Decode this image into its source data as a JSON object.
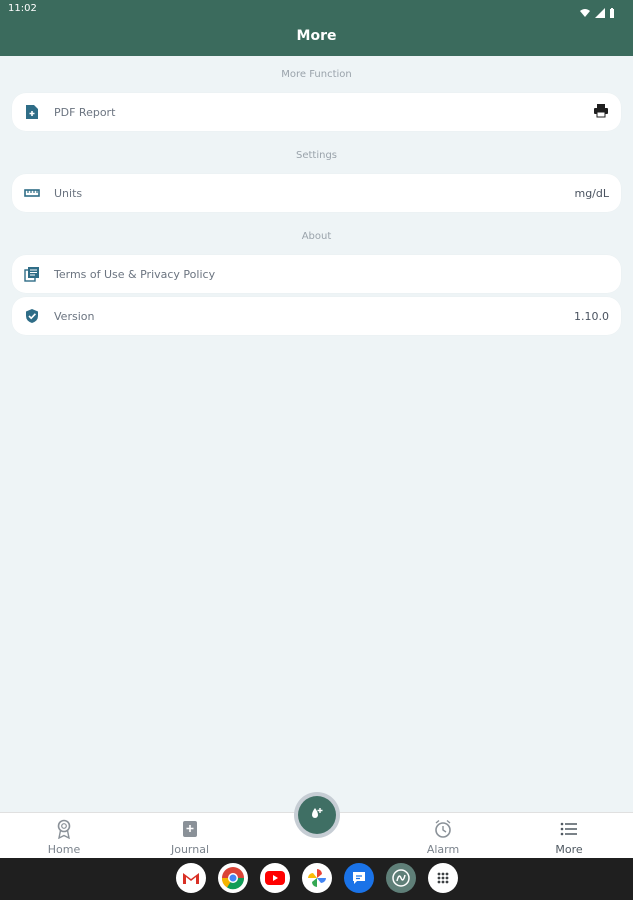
{
  "status_bar": {
    "time": "11:02"
  },
  "header": {
    "title": "More"
  },
  "sections": {
    "more_function": {
      "title": "More Function",
      "items": [
        {
          "label": "PDF Report",
          "icon": "pdf-file-icon",
          "action_icon": "printer-icon"
        }
      ]
    },
    "settings": {
      "title": "Settings",
      "items": [
        {
          "label": "Units",
          "value": "mg/dL",
          "icon": "ruler-icon"
        }
      ]
    },
    "about": {
      "title": "About",
      "items": [
        {
          "label": "Terms of Use & Privacy Policy",
          "icon": "document-list-icon"
        },
        {
          "label": "Version",
          "value": "1.10.0",
          "icon": "shield-check-icon"
        }
      ]
    }
  },
  "bottom_nav": {
    "items": [
      {
        "label": "Home",
        "icon": "award-icon"
      },
      {
        "label": "Journal",
        "icon": "journal-add-icon"
      },
      {
        "label": "Alarm",
        "icon": "alarm-clock-icon"
      },
      {
        "label": "More",
        "icon": "list-icon"
      }
    ],
    "fab_icon": "blood-drop-icon"
  },
  "system_dock": {
    "apps": [
      {
        "name": "Gmail",
        "icon": "gmail-icon"
      },
      {
        "name": "Chrome",
        "icon": "chrome-icon"
      },
      {
        "name": "YouTube",
        "icon": "youtube-icon"
      },
      {
        "name": "Photos",
        "icon": "photos-icon"
      },
      {
        "name": "Messages",
        "icon": "messages-icon"
      },
      {
        "name": "App",
        "icon": "app-logo-icon"
      },
      {
        "name": "All Apps",
        "icon": "app-drawer-icon"
      }
    ]
  },
  "colors": {
    "header": "#3b6b5d",
    "background": "#eef4f6",
    "card_icon": "#2f6d87",
    "fab": "#3f6f64",
    "system_bar": "#1f1f1f"
  }
}
